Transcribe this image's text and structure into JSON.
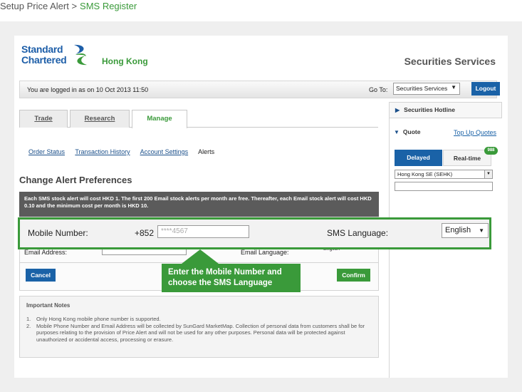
{
  "breadcrumb": {
    "parent": "Setup Price Alert >",
    "current": "SMS Register"
  },
  "brand": {
    "line1": "Standard",
    "line2": "Chartered",
    "region": "Hong Kong",
    "service": "Securities Services"
  },
  "login_bar": {
    "message": "You are logged in as on 10 Oct 2013 11:50",
    "goto_label": "Go To:",
    "goto_value": "Securities Services",
    "logout_label": "Logout"
  },
  "tabs": [
    {
      "label": "Trade"
    },
    {
      "label": "Research"
    },
    {
      "label": "Manage"
    }
  ],
  "subnav": [
    {
      "label": "Order Status"
    },
    {
      "label": "Transaction History"
    },
    {
      "label": "Account Settings"
    },
    {
      "label": "Alerts"
    }
  ],
  "page_title": "Change Alert Preferences",
  "info_text": "Each SMS stock alert will cost HKD 1. The first 200 Email stock alerts per month are free. Thereafter, each Email stock alert will cost HKD 0.10 and the minimum cost per month is HKD 10.",
  "form": {
    "mobile_label": "Mobile Number:",
    "mobile_prefix": "+852",
    "mobile_placeholder": "****4567",
    "sms_language_label": "SMS Language:",
    "sms_language_value": "English",
    "email_label": "Email Address:",
    "email_language_label": "Email Language:",
    "email_language_value": "English"
  },
  "buttons": {
    "cancel": "Cancel",
    "confirm": "Confirm"
  },
  "notes": {
    "title": "Important Notes",
    "items": [
      {
        "num": "1.",
        "text": "Only Hong Kong mobile phone number is supported."
      },
      {
        "num": "2.",
        "text": "Mobile Phone Number and Email Address will be collected by SunGard MarketMap. Collection of personal data from customers shall be for purposes relating to the provision of Price Alert and will not be used for any other purposes. Personal data will be protected against unauthorized or accidental access, processing or erasure."
      }
    ]
  },
  "sidebar": {
    "hotline": "Securities Hotline",
    "quote": "Quote",
    "topup": "Top Up Quotes",
    "tab_delayed": "Delayed",
    "tab_realtime": "Real-time",
    "badge": "988",
    "exchange": "Hong Kong SE (SEHK)"
  },
  "callout": "Enter the Mobile Number and choose the SMS Language",
  "colors": {
    "brand_green": "#3a9a3a",
    "brand_blue": "#1a62a7",
    "info_bg": "#5b5b5b"
  }
}
